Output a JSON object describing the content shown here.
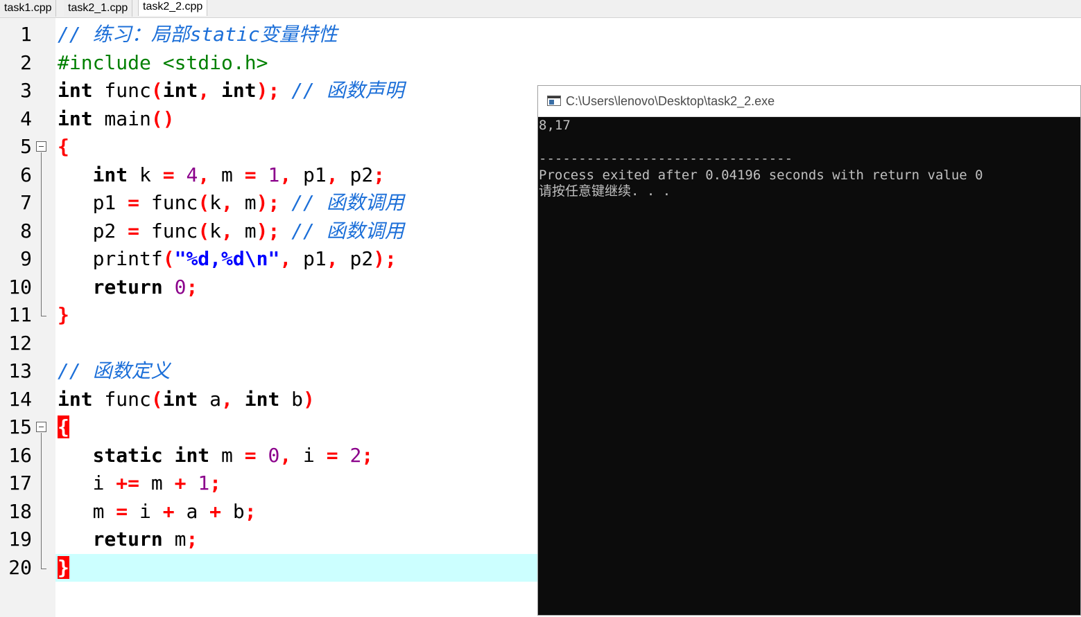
{
  "tabs": [
    "task1.cpp",
    "task2_1.cpp",
    "task2_2.cpp"
  ],
  "active_tab": "task2_2.cpp",
  "line_numbers": [
    "1",
    "2",
    "3",
    "4",
    "5",
    "6",
    "7",
    "8",
    "9",
    "10",
    "11",
    "12",
    "13",
    "14",
    "15",
    "16",
    "17",
    "18",
    "19",
    "20"
  ],
  "code": {
    "l1_comment": "// 练习：局部static变量特性",
    "l2_include": "#include <stdio.h>",
    "l3_int": "int",
    "l3_name": " func",
    "l3_int2": "int",
    "l3_int3": "int",
    "l3_comment": "// 函数声明",
    "l4_int": "int",
    "l4_name": " main",
    "l6_int": "int",
    "l6_k": " k ",
    "l6_m": " m ",
    "l6_p": " p1",
    "l6_p2": " p2",
    "num_4": "4",
    "num_1": "1",
    "l7_p1": "p1 ",
    "l7_func": " func",
    "l7_k": "k",
    "l7_m": " m",
    "l7_comment": "// 函数调用",
    "l8_p2": "p2 ",
    "l9_printf": "printf",
    "l9_str": "\"%d,%d\\n\"",
    "l9_p1": " p1",
    "l9_p2": " p2",
    "l10_return": "return",
    "num_0": "0",
    "l13_comment": "// 函数定义",
    "l14_a": " a",
    "l14_b": " b",
    "l16_static": "static",
    "l16_m": " m ",
    "l16_i": " i ",
    "num_2": "2",
    "l17_i": "i ",
    "l17_m": " m ",
    "l18_m": "m ",
    "l18_i": " i ",
    "l18_a": " a ",
    "l18_b": " b",
    "l19_m": " m"
  },
  "console": {
    "title": "C:\\Users\\lenovo\\Desktop\\task2_2.exe",
    "lines": [
      "8,17",
      "",
      "--------------------------------",
      "Process exited after 0.04196 seconds with return value 0",
      "请按任意键继续. . ."
    ]
  }
}
